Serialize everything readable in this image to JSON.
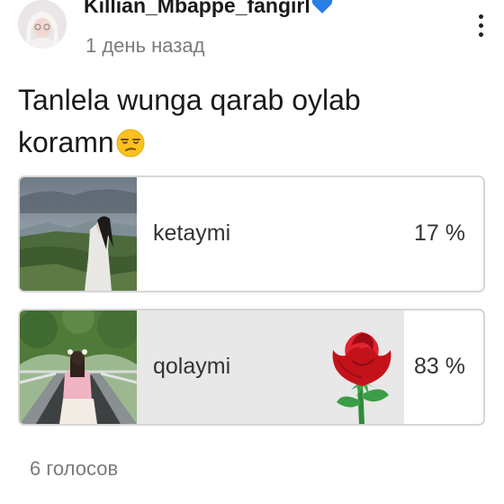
{
  "post": {
    "author": "Killian_Mbappe_fangirl",
    "author_badge_icon": "blue-heart-icon",
    "timestamp": "1 день назад",
    "text_line1": "Tanlela wunga qarab oylab",
    "text_line2": "koramn",
    "text_emoji_icon": "unamused-face-icon"
  },
  "poll": {
    "options": [
      {
        "label": "ketaymi",
        "percent": 17,
        "percent_text": "17 %",
        "image_icon": "landscape-girl-photo"
      },
      {
        "label": "qolaymi",
        "percent": 83,
        "percent_text": "83 %",
        "image_icon": "bridge-girl-photo",
        "decoration_icon": "red-rose-icon"
      }
    ],
    "votes_text": "6 голосов"
  },
  "colors": {
    "poll_fill": "#e8e8e8",
    "poll_border": "#d6d6d6",
    "secondary_text": "#7b7b7b",
    "heart_blue": "#2a7fe6",
    "rose_red": "#c4121b"
  }
}
